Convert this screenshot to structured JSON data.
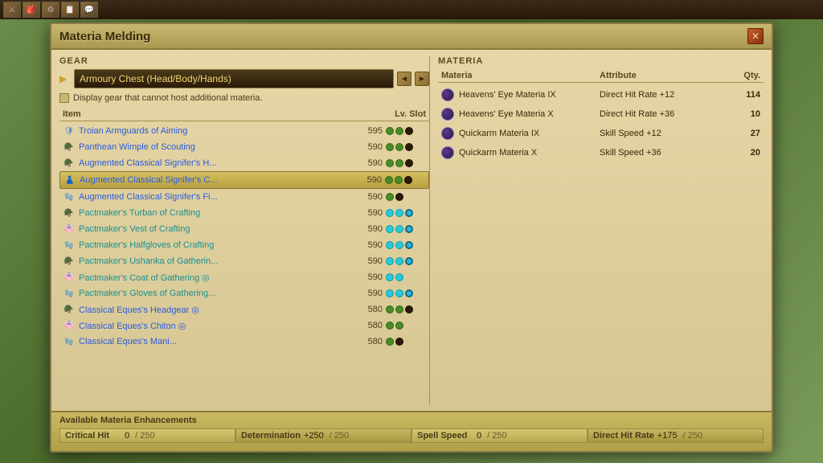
{
  "window": {
    "title": "Materia Melding",
    "close_label": "✕"
  },
  "gear_section": {
    "label": "GEAR",
    "dropdown": {
      "value": "Armoury Chest (Head/Body/Hands)",
      "arrow": "▶"
    },
    "checkbox_label": "Display gear that cannot host additional materia.",
    "columns": {
      "item": "Item",
      "lv_slot": "Lv. Slot"
    },
    "items": [
      {
        "name": "Troian Armguards of Aiming",
        "lv": 595,
        "slots": [
          "green",
          "green",
          "dark"
        ],
        "color": "blue",
        "icon_type": "blue",
        "selected": false
      },
      {
        "name": "Panthean Wimple of Scouting",
        "lv": 590,
        "slots": [
          "green",
          "green",
          "dark"
        ],
        "color": "blue",
        "icon_type": "teal",
        "selected": false
      },
      {
        "name": "Augmented Classical Signifer's H...",
        "lv": 590,
        "slots": [
          "green",
          "green",
          "dark"
        ],
        "color": "blue",
        "icon_type": "teal",
        "selected": false
      },
      {
        "name": "Augmented Classical Signifer's C...",
        "lv": 590,
        "slots": [
          "green",
          "green",
          "dark"
        ],
        "color": "blue",
        "icon_type": "orange",
        "selected": true
      },
      {
        "name": "Augmented Classical Signifer's Fi...",
        "lv": 590,
        "slots": [
          "green",
          "dark"
        ],
        "color": "blue",
        "icon_type": "teal",
        "selected": false
      },
      {
        "name": "Pactmaker's Turban of Crafting",
        "lv": 590,
        "slots": [
          "cyan",
          "cyan",
          "cyan_ring"
        ],
        "color": "teal",
        "icon_type": "teal",
        "selected": false
      },
      {
        "name": "Pactmaker's Vest of Crafting",
        "lv": 590,
        "slots": [
          "cyan",
          "cyan",
          "cyan_ring"
        ],
        "color": "teal",
        "icon_type": "teal",
        "selected": false
      },
      {
        "name": "Pactmaker's Halfgloves of Crafting",
        "lv": 590,
        "slots": [
          "cyan",
          "cyan",
          "cyan_ring"
        ],
        "color": "teal",
        "icon_type": "teal",
        "selected": false
      },
      {
        "name": "Pactmaker's Ushanka of Gatherin...",
        "lv": 590,
        "slots": [
          "cyan",
          "cyan",
          "cyan_ring"
        ],
        "color": "teal",
        "icon_type": "teal",
        "selected": false
      },
      {
        "name": "Pactmaker's Coat of Gathering ◎",
        "lv": 590,
        "slots": [
          "cyan",
          "cyan"
        ],
        "color": "teal",
        "icon_type": "teal",
        "selected": false
      },
      {
        "name": "Pactmaker's Gloves of Gathering...",
        "lv": 590,
        "slots": [
          "cyan",
          "cyan",
          "cyan_ring"
        ],
        "color": "teal",
        "icon_type": "teal",
        "selected": false
      },
      {
        "name": "Classical Eques's Headgear ◎",
        "lv": 580,
        "slots": [
          "green",
          "green",
          "dark"
        ],
        "color": "blue",
        "icon_type": "blue",
        "selected": false
      },
      {
        "name": "Classical Eques's Chiton ◎",
        "lv": 580,
        "slots": [
          "green",
          "green"
        ],
        "color": "blue",
        "icon_type": "blue",
        "selected": false
      },
      {
        "name": "Classical Eques's Mani...",
        "lv": 580,
        "slots": [
          "green",
          "dark"
        ],
        "color": "blue",
        "icon_type": "blue",
        "selected": false
      }
    ]
  },
  "materia_section": {
    "label": "MATERIA",
    "columns": {
      "materia": "Materia",
      "attribute": "Attribute",
      "qty": "Qty."
    },
    "items": [
      {
        "name": "Heavens' Eye Materia IX",
        "attribute": "Direct Hit Rate +12",
        "qty": "114"
      },
      {
        "name": "Heavens' Eye Materia X",
        "attribute": "Direct Hit Rate +36",
        "qty": "10"
      },
      {
        "name": "Quickarm Materia IX",
        "attribute": "Skill Speed +12",
        "qty": "27"
      },
      {
        "name": "Quickarm Materia X",
        "attribute": "Skill Speed +36",
        "qty": "20"
      }
    ]
  },
  "available_bar": {
    "title": "Available Materia Enhancements",
    "stats": [
      {
        "name": "Critical Hit",
        "value": "0",
        "sep": "/",
        "max": "250"
      },
      {
        "name": "Determination",
        "value": "+250",
        "sep": "/",
        "max": "250"
      },
      {
        "name": "Spell Speed",
        "value": "0",
        "sep": "/",
        "max": "250"
      },
      {
        "name": "Direct Hit Rate",
        "value": "+175",
        "sep": "/",
        "max": "250"
      }
    ]
  },
  "icons": {
    "gear": "⚙",
    "settings": "⚙",
    "prev": "◄",
    "next": "►",
    "arrow_right": "▶"
  }
}
